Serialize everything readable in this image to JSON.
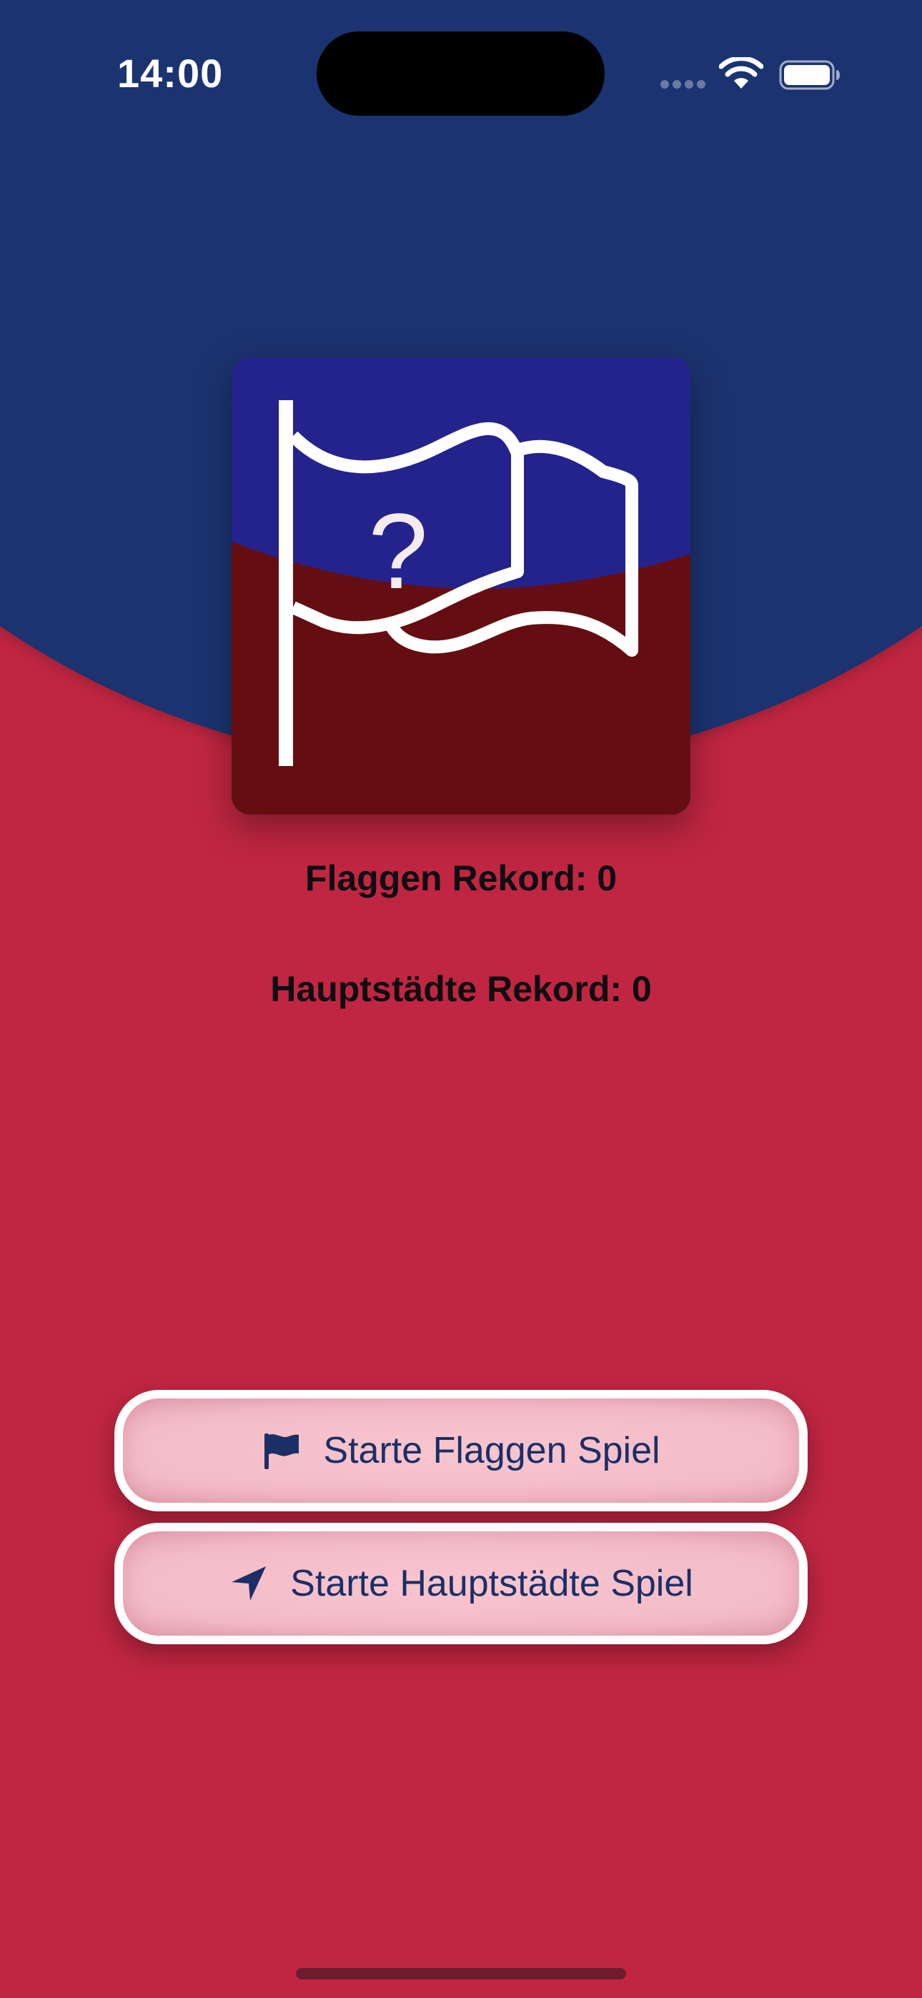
{
  "status_bar": {
    "time": "14:00",
    "wifi_icon": "wifi-icon",
    "battery_icon": "battery-icon",
    "signal_icon": "signal-dots-icon"
  },
  "logo": {
    "question_mark": "?",
    "icon_name": "flag-question-icon"
  },
  "records": {
    "flags": "Flaggen Rekord: 0",
    "capitals": "Hauptstädte Rekord: 0"
  },
  "buttons": {
    "start_flags": {
      "label": "Starte Flaggen Spiel",
      "icon": "flag-icon"
    },
    "start_capitals": {
      "label": "Starte Hauptstädte Spiel",
      "icon": "location-arrow-icon"
    }
  },
  "colors": {
    "background_red": "#c02641",
    "top_blue": "#1b3370",
    "logo_blue": "#24228c",
    "logo_darkred": "#650e12",
    "button_fill": "#f6bfca",
    "button_text": "#1b2f66"
  }
}
